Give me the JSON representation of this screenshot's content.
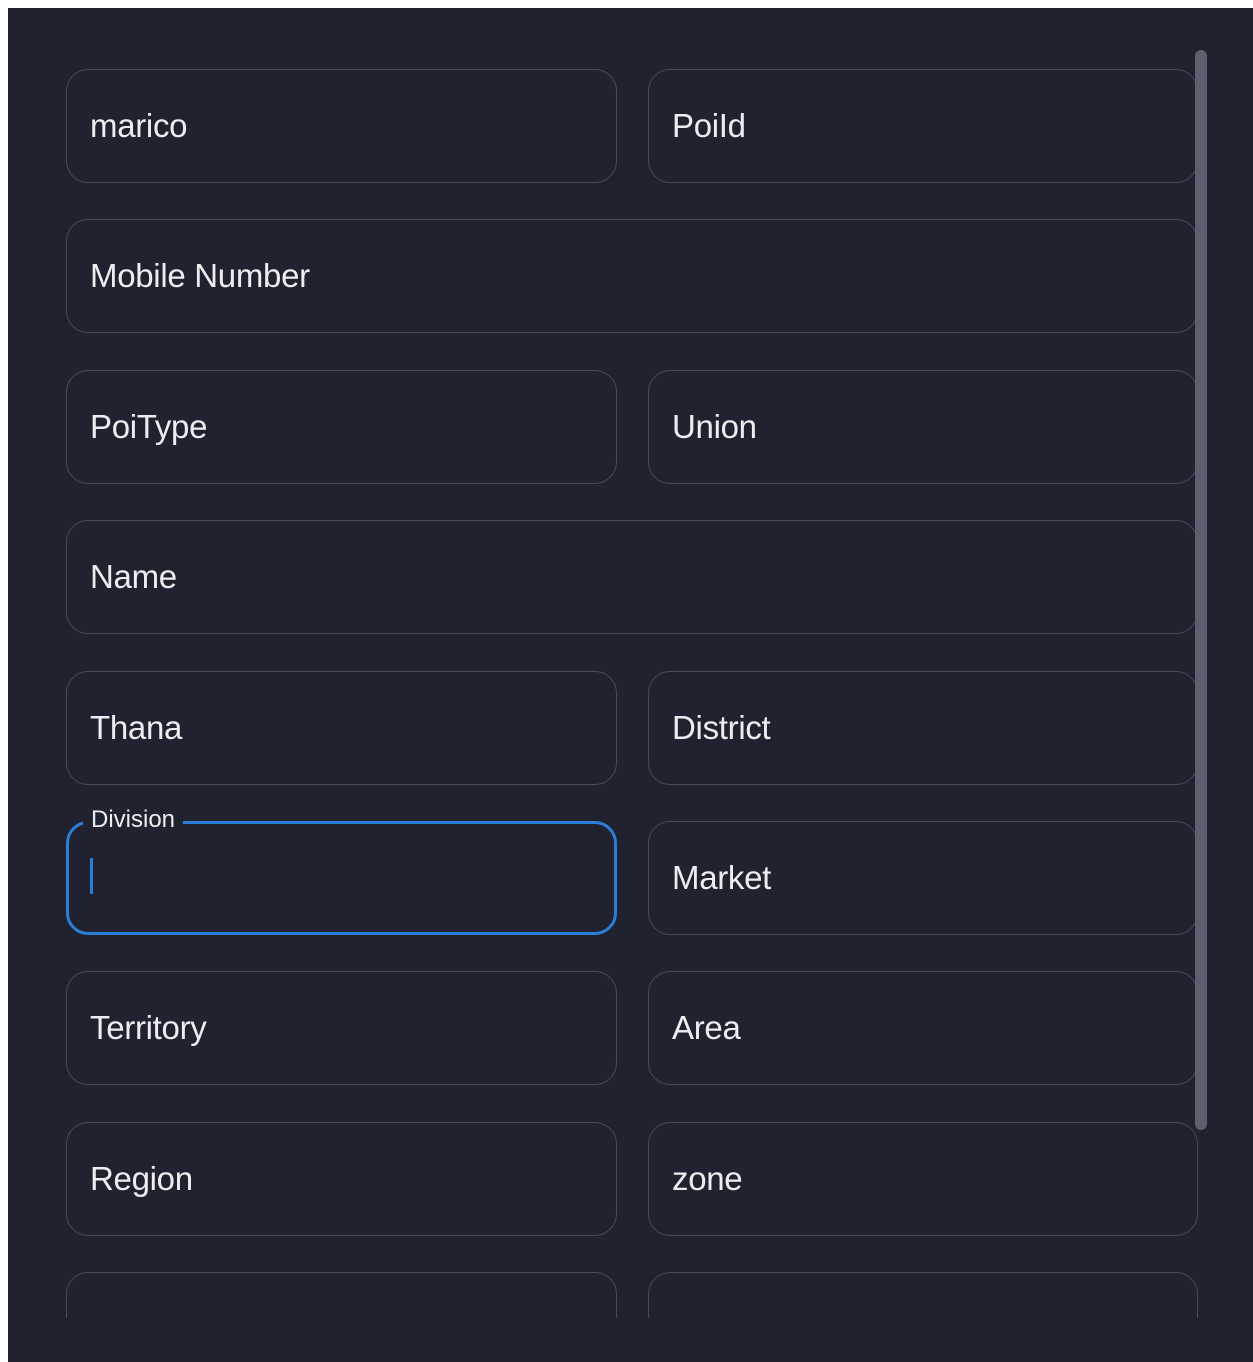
{
  "form": {
    "fields": {
      "marico": "marico",
      "poiid": "PoiId",
      "mobile_number": "Mobile Number",
      "poitype": "PoiType",
      "union": "Union",
      "name": "Name",
      "thana": "Thana",
      "district": "District",
      "division_label": "Division",
      "division_value": "",
      "market": "Market",
      "territory": "Territory",
      "area": "Area",
      "region": "Region",
      "zone": "zone"
    }
  },
  "colors": {
    "background": "#21222f",
    "border": "#474a5a",
    "focus_accent": "#2c7fd6",
    "text": "#ededf1",
    "scrollbar": "#5d5f6e"
  }
}
